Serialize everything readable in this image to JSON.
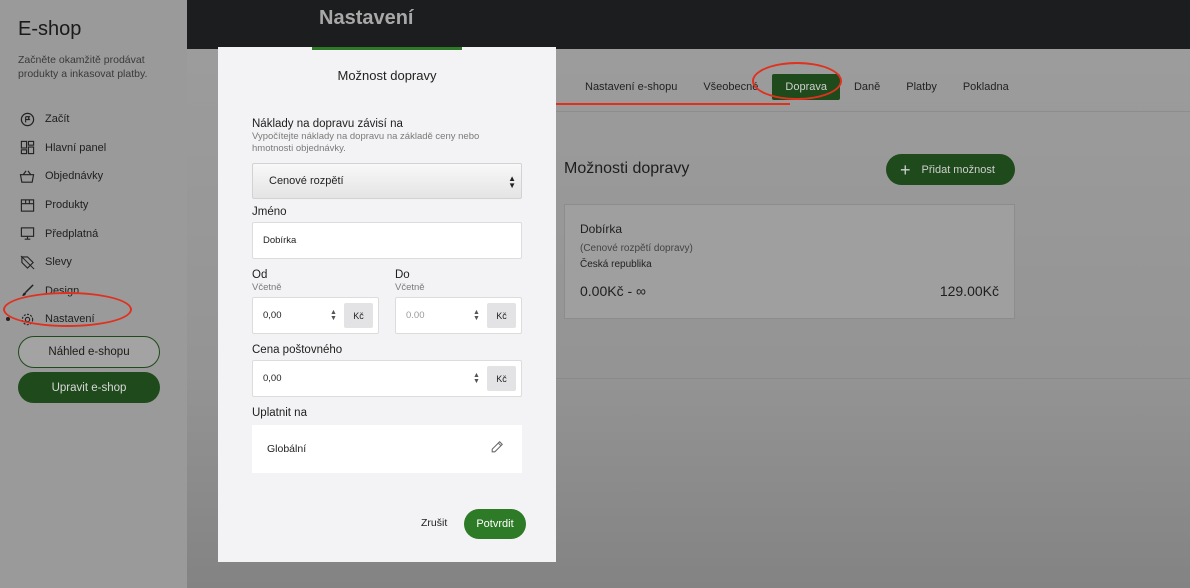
{
  "sidebar": {
    "title": "E-shop",
    "description": "Začněte okamžitě prodávat produkty a inkasovat platby.",
    "items": [
      {
        "label": "Začít",
        "icon": "flag-icon"
      },
      {
        "label": "Hlavní panel",
        "icon": "dashboard-icon"
      },
      {
        "label": "Objednávky",
        "icon": "basket-icon"
      },
      {
        "label": "Produkty",
        "icon": "box-icon"
      },
      {
        "label": "Předplatná",
        "icon": "monitor-icon"
      },
      {
        "label": "Slevy",
        "icon": "tag-icon"
      },
      {
        "label": "Design",
        "icon": "brush-icon"
      },
      {
        "label": "Nastavení",
        "icon": "gear-icon",
        "active": true
      }
    ],
    "preview_button": "Náhled e-shopu",
    "edit_button": "Upravit e-shop"
  },
  "header": {
    "title": "Nastavení"
  },
  "tabs": [
    "Nastavení e-shopu",
    "Všeobecné",
    "Doprava",
    "Daně",
    "Platby",
    "Pokladna"
  ],
  "active_tab": "Doprava",
  "main": {
    "section_title": "Možnosti dopravy",
    "add_button": "Přidat možnost",
    "card": {
      "name": "Dobírka",
      "type": "(Cenové rozpětí dopravy)",
      "country": "Česká republika",
      "range": "0.00Kč - ∞",
      "price": "129.00Kč"
    }
  },
  "modal": {
    "title": "Možnost dopravy",
    "cost_label": "Náklady na dopravu závisí na",
    "cost_help": "Vypočítejte náklady na dopravu na základě ceny nebo hmotnosti objednávky.",
    "cost_select": "Cenové rozpětí",
    "name_label": "Jméno",
    "name_value": "Dobírka",
    "from_label": "Od",
    "from_sub": "Včetně",
    "from_value": "0,00",
    "to_label": "Do",
    "to_sub": "Včetně",
    "to_placeholder": "0.00",
    "currency": "Kč",
    "postage_label": "Cena poštovného",
    "postage_value": "0,00",
    "apply_label": "Uplatnit na",
    "apply_value": "Globální",
    "cancel": "Zrušit",
    "confirm": "Potvrdit"
  },
  "colors": {
    "accent": "#2d7a27",
    "annotation": "#e0311f"
  }
}
